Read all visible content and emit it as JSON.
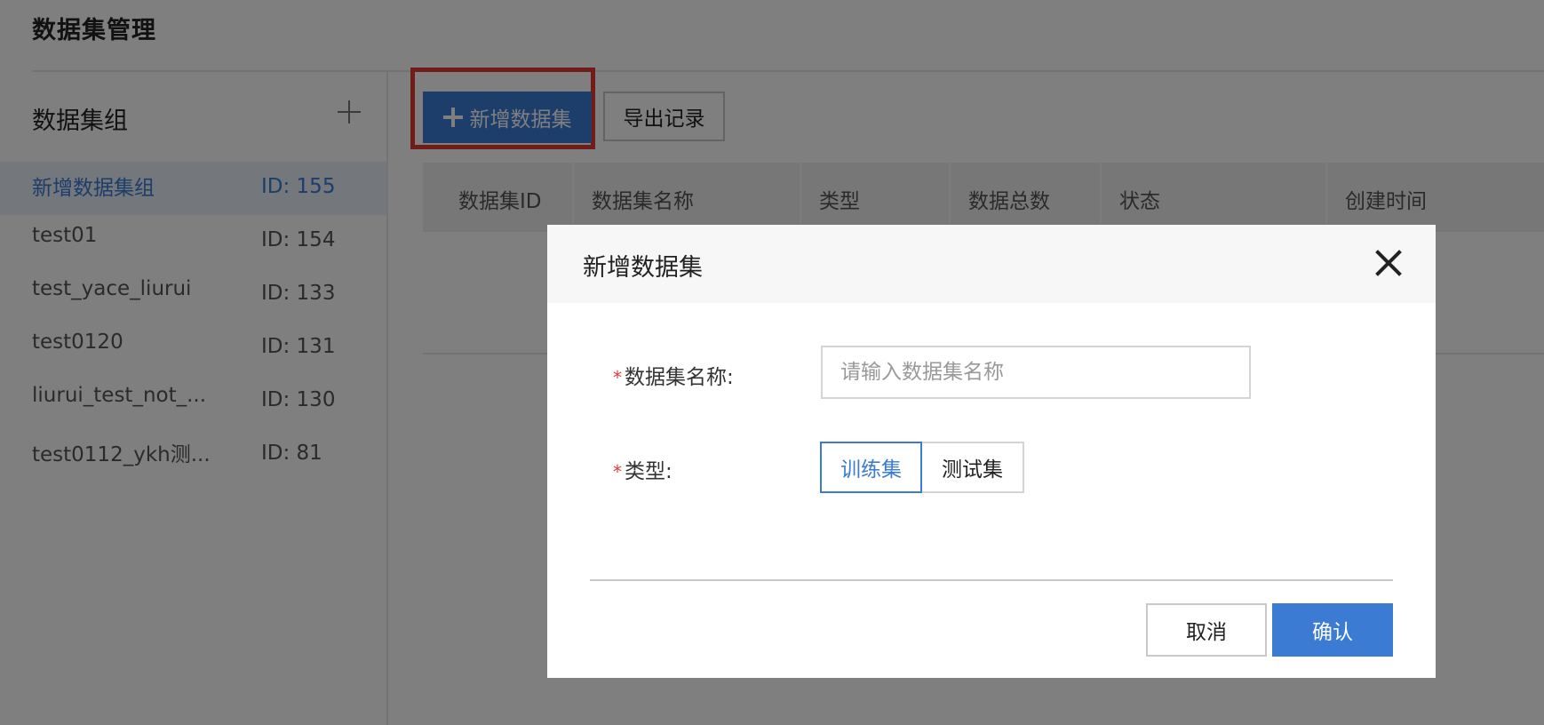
{
  "page": {
    "title": "数据集管理"
  },
  "sidebar": {
    "title": "数据集组",
    "add_icon": "plus-icon",
    "items": [
      {
        "name": "新增数据集组",
        "id": "ID: 155",
        "active": true
      },
      {
        "name": "test01",
        "id": "ID: 154",
        "active": false
      },
      {
        "name": "test_yace_liurui",
        "id": "ID: 133",
        "active": false
      },
      {
        "name": "test0120",
        "id": "ID: 131",
        "active": false
      },
      {
        "name": "liurui_test_not_...",
        "id": "ID: 130",
        "active": false
      },
      {
        "name": "test0112_ykh测...",
        "id": "ID: 81",
        "active": false
      }
    ]
  },
  "toolbar": {
    "add_dataset_label": "新增数据集",
    "add_icon": "plus-icon",
    "export_label": "导出记录",
    "highlight_color": "#e53935"
  },
  "table": {
    "columns": [
      "数据集ID",
      "数据集名称",
      "类型",
      "数据总数",
      "状态",
      "创建时间"
    ]
  },
  "modal": {
    "title": "新增数据集",
    "close_icon": "close-icon",
    "fields": {
      "name_label": "数据集名称:",
      "name_placeholder": "请输入数据集名称",
      "type_label": "类型:",
      "type_options": [
        "训练集",
        "测试集"
      ],
      "type_selected": "训练集",
      "required_mark": "*"
    },
    "cancel_label": "取消",
    "confirm_label": "确认"
  },
  "colors": {
    "primary": "#3b7bd4",
    "required": "#e53935",
    "overlay": "rgba(0,0,0,0.5)"
  }
}
